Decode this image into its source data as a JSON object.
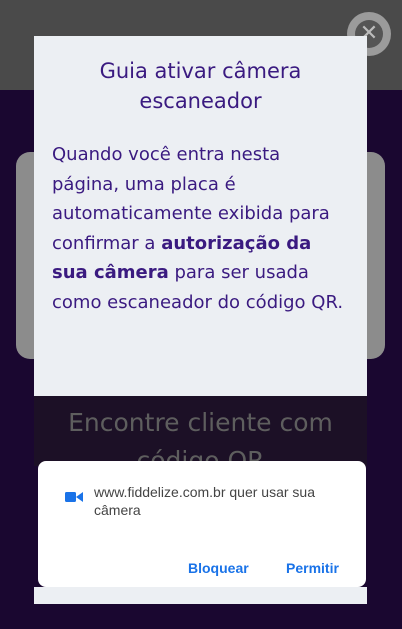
{
  "guide": {
    "title": "Guia ativar câmera escaneador",
    "text_before": "Quando você entra nesta página, uma placa é automaticamente exibida para confirmar a ",
    "text_bold": "autorização da sua câmera",
    "text_after": " para ser usada como escaneador do código QR."
  },
  "background": {
    "heading": "Encontre cliente com código QR"
  },
  "permission": {
    "message": "www.fiddelize.com.br quer usar sua câmera",
    "block_label": "Bloquear",
    "allow_label": "Permitir",
    "icon": "video-camera-icon"
  },
  "close_icon": "close-icon",
  "colors": {
    "accent": "#3a1a80",
    "link": "#1a73e8",
    "background": "#1a0730"
  }
}
